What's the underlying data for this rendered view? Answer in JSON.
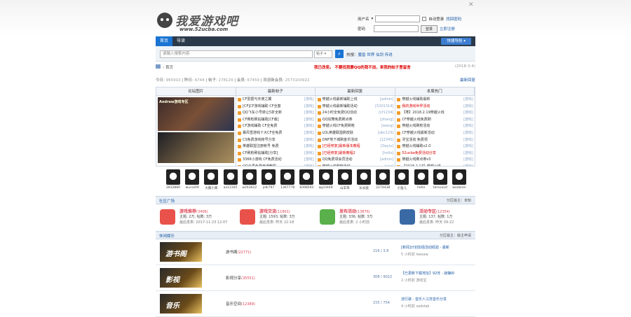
{
  "site": {
    "logo_text": "我爱游戏吧",
    "logo_url": "www.52ucba.com"
  },
  "login": {
    "user_label": "用户名",
    "user_mode": "用户名",
    "pass_label": "密码",
    "remember": "自动登录",
    "forgot": "找回密码",
    "login_btn": "登录",
    "register": "立即注册"
  },
  "nav": {
    "tabs": [
      "首页",
      "导读"
    ],
    "quick": "快捷导航"
  },
  "search": {
    "placeholder": "请输入搜索内容",
    "type": "帖子",
    "hot_label": "热搜：",
    "hot": "魔兽 世界 仙剑 传说"
  },
  "crumb": {
    "home": "首页",
    "notice": "我已改变。 不要找我要QQ的我不加，来我的帖子里留言",
    "date": "2018-3-4"
  },
  "stats": {
    "today_label": "今日:",
    "today": "965910",
    "yesterday_label": "昨日:",
    "yesterday": "6744",
    "posts_label": "帖子:",
    "posts": "278129",
    "members_label": "会员:",
    "members": "67459",
    "newest_label": "欢迎新会员:",
    "newest": "2573100922",
    "right": "最新回复"
  },
  "grid": {
    "headers": [
      "论坛图片",
      "最新帖子",
      "最新回复",
      "本周热门"
    ],
    "pic_caption": "Andrew游戏专区",
    "col1": [
      {
        "t": "CF雷霆与天使之翼",
        "k": "[游戏]",
        "red": false
      },
      {
        "t": "[CF]CF游戏辅助 CF全套",
        "k": "[游戏]",
        "red": false
      },
      {
        "t": "QQ飞车小号转让5折全新",
        "k": "[游戏]",
        "red": false
      },
      {
        "t": "CF刷枪刷钻辅助[CF版]",
        "k": "[游戏]",
        "red": false
      },
      {
        "t": "CF游戏辅助 CF全免费",
        "k": "[游戏]",
        "red": false
      },
      {
        "t": "暴风雪游戏十大CF全免费",
        "k": "[游戏]",
        "red": false
      },
      {
        "t": "CS免费游戏帐号分享",
        "k": "[游戏]",
        "red": false
      },
      {
        "t": "英雄联盟注册帐号 免费",
        "k": "[游戏]",
        "red": false
      },
      {
        "t": "CF刷枪刷钻辅助[分享]",
        "k": "[游戏]",
        "red": false
      },
      {
        "t": "3366小游戏 CF免费活动",
        "k": "[游戏]",
        "red": false
      },
      {
        "t": "QQ会员免费开通教程",
        "k": "[游戏]",
        "red": false
      }
    ],
    "col2": [
      {
        "t": "穿越火线最新辅助上线",
        "k": "[admin]",
        "red": false
      },
      {
        "t": "穿越火线最新辅助活动",
        "k": "[5201314]",
        "red": false
      },
      {
        "t": "24小时全免费QQ活动",
        "k": "[cf1234]",
        "red": false
      },
      {
        "t": "QQ炫舞免费刷点券",
        "k": "[zhang]",
        "red": false
      },
      {
        "t": "穿越火线CF免费刷枪",
        "k": "[wang]",
        "red": false
      },
      {
        "t": "LOL英雄联盟刷皮肤",
        "k": "[abc123]",
        "red": false
      },
      {
        "t": "DNF地下城刷金币活动",
        "k": "[12345]",
        "red": false
      },
      {
        "t": "[已经修复]最新版本教程",
        "k": "[3wyiu]",
        "red": true
      },
      {
        "t": "[已经修复]最新教程2",
        "k": "[hello]",
        "red": true
      },
      {
        "t": "QQ免费领会员活动",
        "k": "[admin]",
        "red": false
      },
      {
        "t": "穿越火线刷枪活动",
        "k": "[yiyi]",
        "red": false
      }
    ],
    "col3": [
      {
        "t": "穿越火线辅助最新",
        "k": "[游戏]",
        "red": false
      },
      {
        "t": "我的游戏世界活动",
        "k": "[游戏]",
        "red": true
      },
      {
        "t": "【寒】2018.2.19穿越火线",
        "k": "[游戏]",
        "red": false
      },
      {
        "t": "CF穿越火线免费刷",
        "k": "[游戏]",
        "red": false
      },
      {
        "t": "穿越火线刷枪活动",
        "k": "[游戏]",
        "red": false
      },
      {
        "t": "CF穿越火线最新活动",
        "k": "[游戏]",
        "red": false
      },
      {
        "t": "寻宝活动 免费领",
        "k": "[游戏]",
        "red": false
      },
      {
        "t": "穿越火线辅助v2.0",
        "k": "[游戏]",
        "red": false
      },
      {
        "t": "52ucba免费活动分享",
        "k": "[游戏]",
        "red": true
      },
      {
        "t": "穿越火线刷点券v3",
        "k": "[游戏]",
        "red": false
      },
      {
        "t": "【2018.2.13】穿越火线",
        "k": "[游戏]",
        "red": false
      }
    ]
  },
  "avatars": [
    "2833880",
    "wunai09",
    "大鹏小黄",
    "aa12345",
    "w263622",
    "jidk797",
    "1367778",
    "8398593",
    "qq33449",
    "山羊哥",
    "长长鹿",
    "2274438",
    "小鱼儿",
    "hehe",
    "tarovood",
    "wodaren"
  ],
  "forum_section": {
    "title": "社区广场",
    "right": "分区版主：未知"
  },
  "forums": [
    {
      "name": "游戏推荐",
      "count": "(3406)",
      "l2": "主题: 2万, 帖数: 3万",
      "l3": "最后发表: 2017-11-23 12:07",
      "color": "#e8524a"
    },
    {
      "name": "游戏交流",
      "count": "(11801)",
      "l2": "主题: 1593, 帖数: 3万",
      "l3": "最后发表: 昨天 22:18",
      "color": "#e8524a"
    },
    {
      "name": "发布活动",
      "count": "(13876)",
      "l2": "主题: 336, 帖数: 3万",
      "l3": "最后发表: 2 小时前",
      "color": "#5ab04a"
    },
    {
      "name": "活动专区",
      "count": "(12354)",
      "l2": "主题: 137, 帖数: 1万",
      "l3": "最后发表: 昨天 09:22",
      "color": "#3a6aa6"
    }
  ],
  "board_section": {
    "title": "休闲娱乐",
    "right": "分区版主：版主申请"
  },
  "boards": [
    {
      "img": "游书阁",
      "name": "游书阁",
      "count": "(22771)",
      "cnt": "216 / 3.8",
      "last": "[新闻]计划加强活动经验 - 最新",
      "last2": "5 小时前 leesaw"
    },
    {
      "img": "影视",
      "name": "影视分享",
      "count": "(35551)",
      "cnt": "308 / 9022",
      "last": "【已更新下载地址】92年 - 寂静岭",
      "last2": "2 小时前 游戏宝"
    },
    {
      "img": "音乐",
      "name": "音乐空间",
      "count": "(12389)",
      "cnt": "155 / 754",
      "last": "流行歌 - 音乐人江苏音乐分享",
      "last2": "4 小时前 sadslab"
    }
  ]
}
